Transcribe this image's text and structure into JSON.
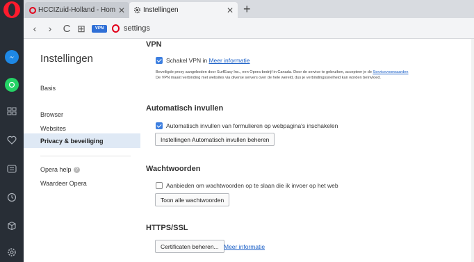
{
  "tabs": [
    {
      "title": "HCCIZuid-Holland - Home",
      "close": "✕"
    },
    {
      "title": "Instellingen",
      "close": "✕"
    }
  ],
  "new_tab": "+",
  "address_bar": {
    "vpn_badge": "VPN",
    "url": "settings"
  },
  "icons": {
    "opera": "opera-logo-icon",
    "messenger": "messenger-icon",
    "whatsapp": "whatsapp-icon",
    "speed_dial": "speed-dial-icon",
    "bookmarks": "heart-icon",
    "news": "news-icon",
    "history": "clock-icon",
    "extensions": "cube-icon",
    "settings": "gear-icon"
  },
  "nav": {
    "back": "‹",
    "forward": "›",
    "reload": "C",
    "grid": "⊞"
  },
  "settings_nav": {
    "heading": "Instellingen",
    "items": [
      "Basis",
      "Browser",
      "Websites",
      "Privacy & beveiliging",
      "Opera help",
      "Waardeer Opera"
    ],
    "active_index": 3
  },
  "vpn": {
    "title": "VPN",
    "checkbox_label": "Schakel VPN in",
    "checkbox_link": "Meer informatie",
    "checked": true,
    "desc_line1": "Beveiligde proxy aangeboden door SurfEasy Inc., een Opera-bedrijf in Canada. Door de service te gebruiken, accepteer je de",
    "desc_link": "Servicevoorwaarden",
    "desc_line2": "De VPN maakt verbinding met websites via diverse servers over de hele wereld, dus je verbindingssnelheid kan worden beïnvloed."
  },
  "autofill": {
    "title": "Automatisch invullen",
    "checkbox_label": "Automatisch invullen van formulieren op webpagina's inschakelen",
    "checked": true,
    "button": "Instellingen Automatisch invullen beheren"
  },
  "passwords": {
    "title": "Wachtwoorden",
    "checkbox_label": "Aanbieden om wachtwoorden op te slaan die ik invoer op het web",
    "checked": false,
    "button": "Toon alle wachtwoorden"
  },
  "https": {
    "title": "HTTPS/SSL",
    "button": "Certificaten beheren...",
    "link": "Meer informatie"
  },
  "colors": {
    "sidebar": "#282e36",
    "accent": "#3d7fe0",
    "link": "#1a5fc7",
    "active_nav": "#dfe9f5",
    "opera_red": "#ff1b2d"
  }
}
